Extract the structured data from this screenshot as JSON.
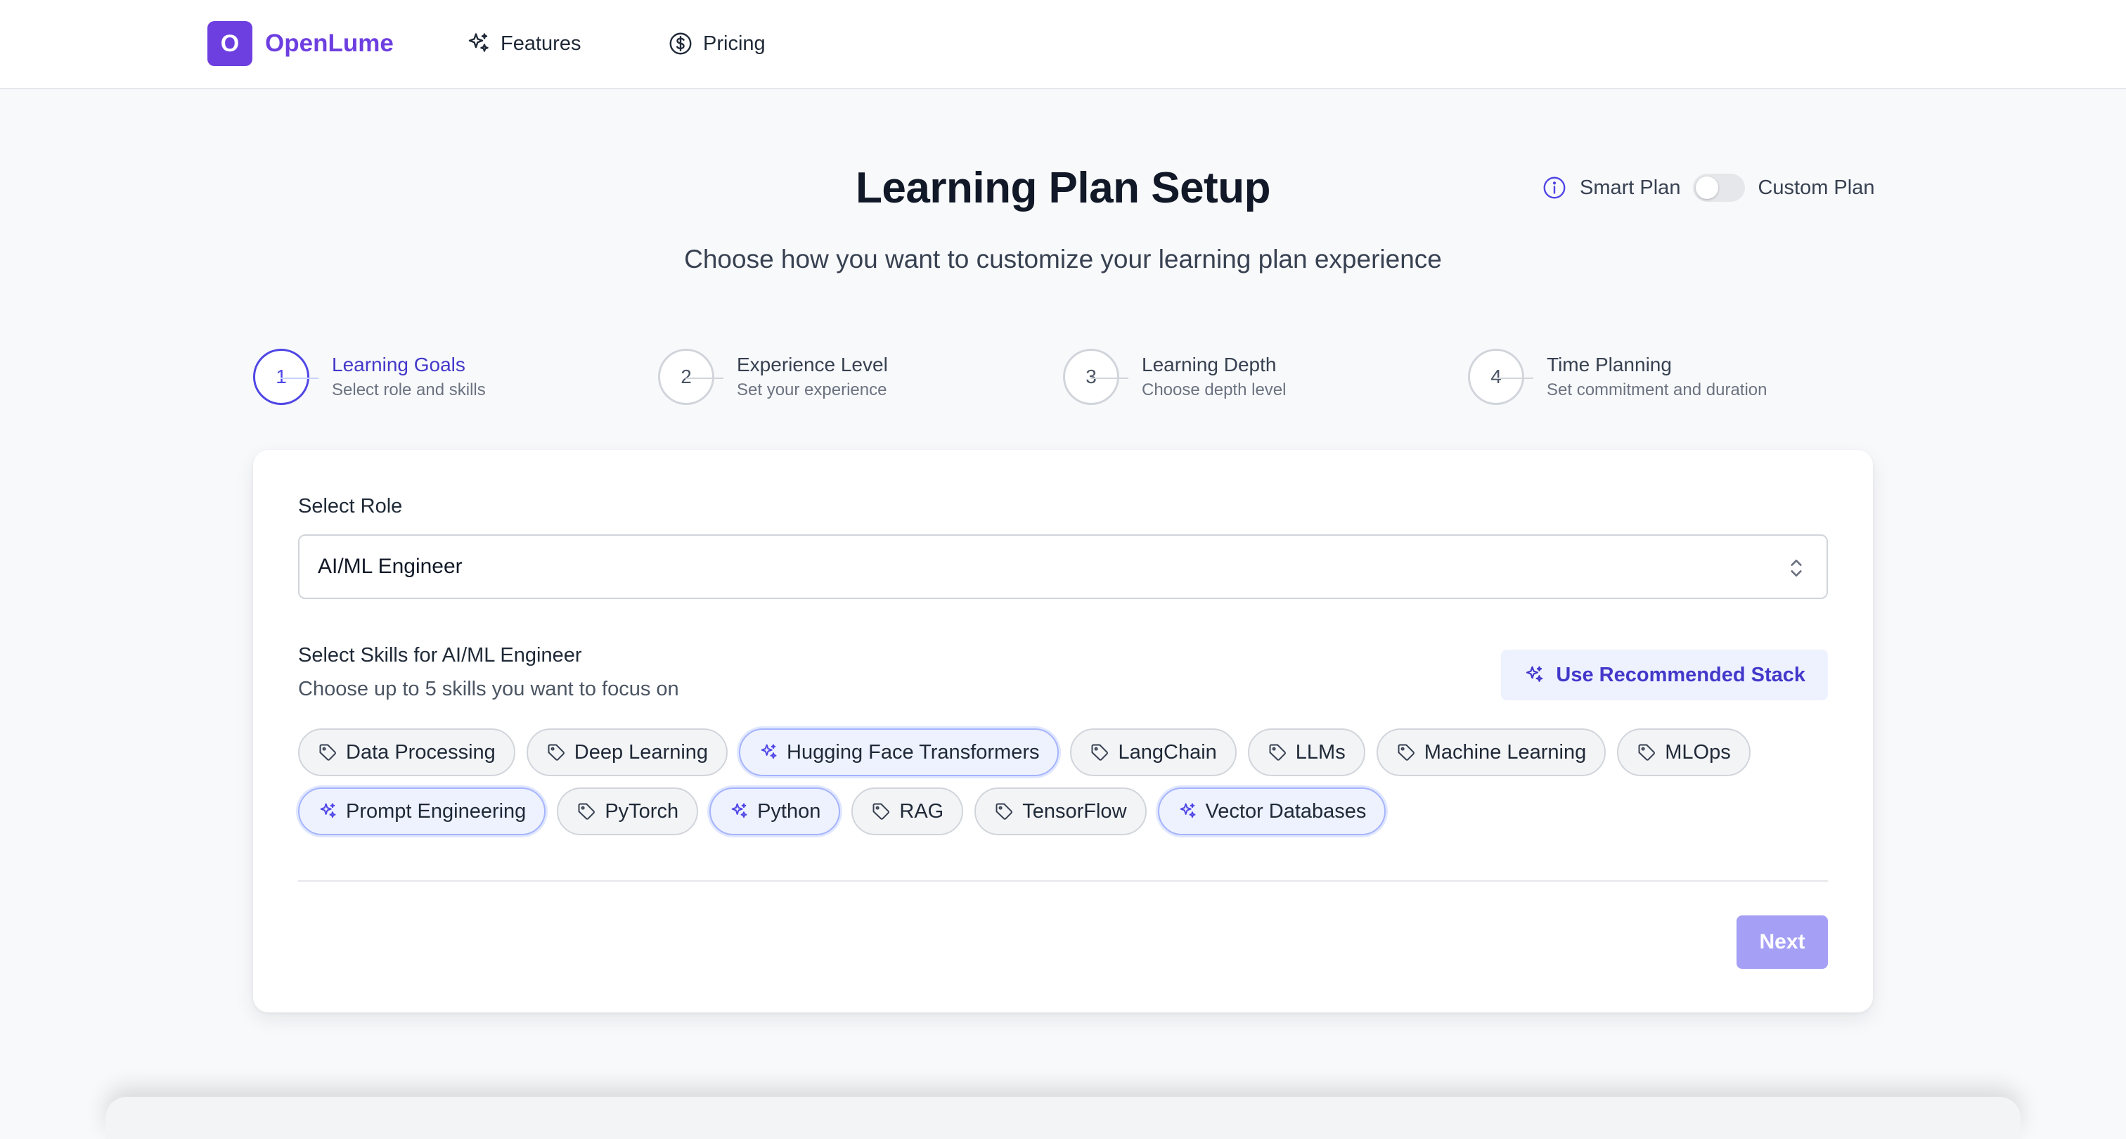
{
  "nav": {
    "brand_letter": "O",
    "brand_name": "OpenLume",
    "items": [
      {
        "label": "Features",
        "icon": "sparkles-icon"
      },
      {
        "label": "Pricing",
        "icon": "dollar-circle-icon"
      }
    ]
  },
  "header": {
    "title": "Learning Plan Setup",
    "subtitle": "Choose how you want to customize your learning plan experience",
    "toggle": {
      "left_label": "Smart Plan",
      "right_label": "Custom Plan",
      "custom_enabled": false
    }
  },
  "steps": [
    {
      "number": "1",
      "label": "Learning Goals",
      "sub": "Select role and skills",
      "active": true
    },
    {
      "number": "2",
      "label": "Experience Level",
      "sub": "Set your experience",
      "active": false
    },
    {
      "number": "3",
      "label": "Learning Depth",
      "sub": "Choose depth level",
      "active": false
    },
    {
      "number": "4",
      "label": "Time Planning",
      "sub": "Set commitment and duration",
      "active": false
    }
  ],
  "form": {
    "role_label": "Select Role",
    "role_value": "AI/ML Engineer",
    "skills_label": "Select Skills for AI/ML Engineer",
    "skills_sub": "Choose up to 5 skills you want to focus on",
    "recommend_label": "Use Recommended Stack",
    "skills": [
      {
        "label": "Data Processing",
        "selected": false
      },
      {
        "label": "Deep Learning",
        "selected": false
      },
      {
        "label": "Hugging Face Transformers",
        "selected": true
      },
      {
        "label": "LangChain",
        "selected": false
      },
      {
        "label": "LLMs",
        "selected": false
      },
      {
        "label": "Machine Learning",
        "selected": false
      },
      {
        "label": "MLOps",
        "selected": false
      },
      {
        "label": "Prompt Engineering",
        "selected": true
      },
      {
        "label": "PyTorch",
        "selected": false
      },
      {
        "label": "Python",
        "selected": true
      },
      {
        "label": "RAG",
        "selected": false
      },
      {
        "label": "TensorFlow",
        "selected": false
      },
      {
        "label": "Vector Databases",
        "selected": true
      }
    ],
    "next_label": "Next"
  },
  "colors": {
    "brand": "#6d3fe0",
    "accent": "#4f46e5",
    "next_disabled": "#a5a0f5"
  }
}
